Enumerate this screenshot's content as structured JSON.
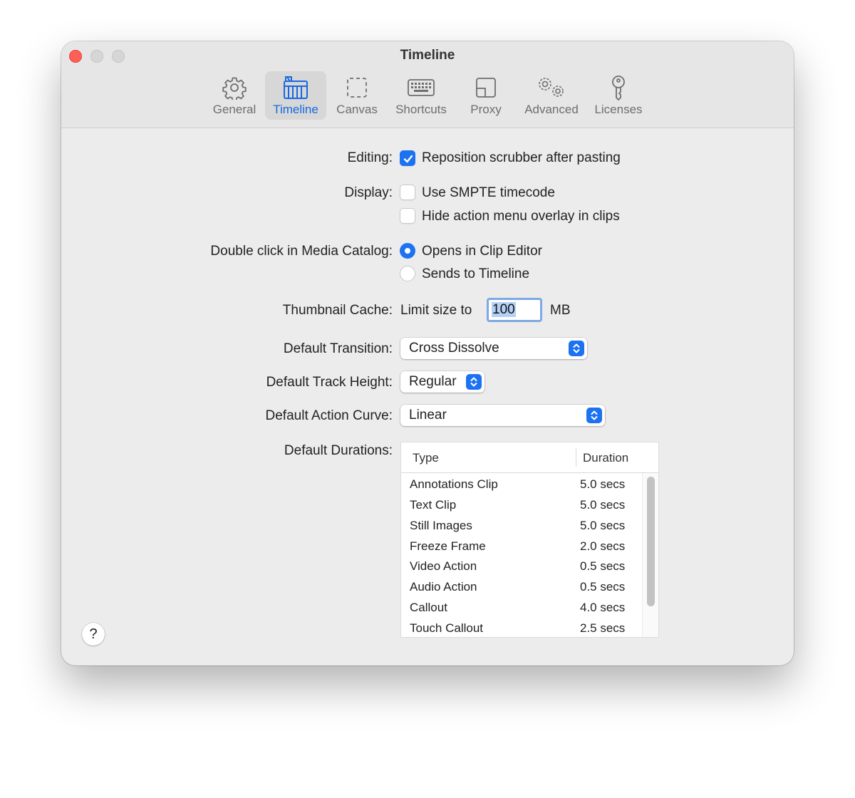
{
  "window": {
    "title": "Timeline"
  },
  "toolbar": {
    "items": [
      {
        "label": "General",
        "icon": "gear-icon",
        "selected": false
      },
      {
        "label": "Timeline",
        "icon": "clapperboard-icon",
        "selected": true
      },
      {
        "label": "Canvas",
        "icon": "dashed-square-icon",
        "selected": false
      },
      {
        "label": "Shortcuts",
        "icon": "keyboard-icon",
        "selected": false
      },
      {
        "label": "Proxy",
        "icon": "proxy-icon",
        "selected": false
      },
      {
        "label": "Advanced",
        "icon": "gears-icon",
        "selected": false
      },
      {
        "label": "Licenses",
        "icon": "key-icon",
        "selected": false
      }
    ]
  },
  "form": {
    "editing_label": "Editing:",
    "editing_option": {
      "label": "Reposition scrubber after pasting",
      "checked": true
    },
    "display_label": "Display:",
    "display_options": [
      {
        "label": "Use SMPTE timecode",
        "checked": false
      },
      {
        "label": "Hide action menu overlay in clips",
        "checked": false
      }
    ],
    "double_click_label": "Double click in Media Catalog:",
    "double_click_options": [
      {
        "label": "Opens in Clip Editor",
        "selected": true
      },
      {
        "label": "Sends to Timeline",
        "selected": false
      }
    ],
    "thumbnail_label": "Thumbnail Cache:",
    "thumbnail_prefix": "Limit size to",
    "thumbnail_value": "100",
    "thumbnail_unit": "MB",
    "transition_label": "Default Transition:",
    "transition_value": "Cross Dissolve",
    "track_height_label": "Default Track Height:",
    "track_height_value": "Regular",
    "action_curve_label": "Default Action Curve:",
    "action_curve_value": "Linear",
    "durations_label": "Default Durations:"
  },
  "durations_table": {
    "columns": [
      "Type",
      "Duration"
    ],
    "rows": [
      {
        "type": "Annotations Clip",
        "duration": "5.0 secs"
      },
      {
        "type": "Text Clip",
        "duration": "5.0 secs"
      },
      {
        "type": "Still Images",
        "duration": "5.0 secs"
      },
      {
        "type": "Freeze Frame",
        "duration": "2.0 secs"
      },
      {
        "type": "Video Action",
        "duration": "0.5 secs"
      },
      {
        "type": "Audio Action",
        "duration": "0.5 secs"
      },
      {
        "type": "Callout",
        "duration": "4.0 secs"
      },
      {
        "type": "Touch Callout",
        "duration": "2.5 secs"
      }
    ]
  },
  "help": {
    "label": "?"
  },
  "colors": {
    "accent": "#1d72f2",
    "close": "#fe5f57",
    "selected_tab_text": "#1769e0"
  }
}
